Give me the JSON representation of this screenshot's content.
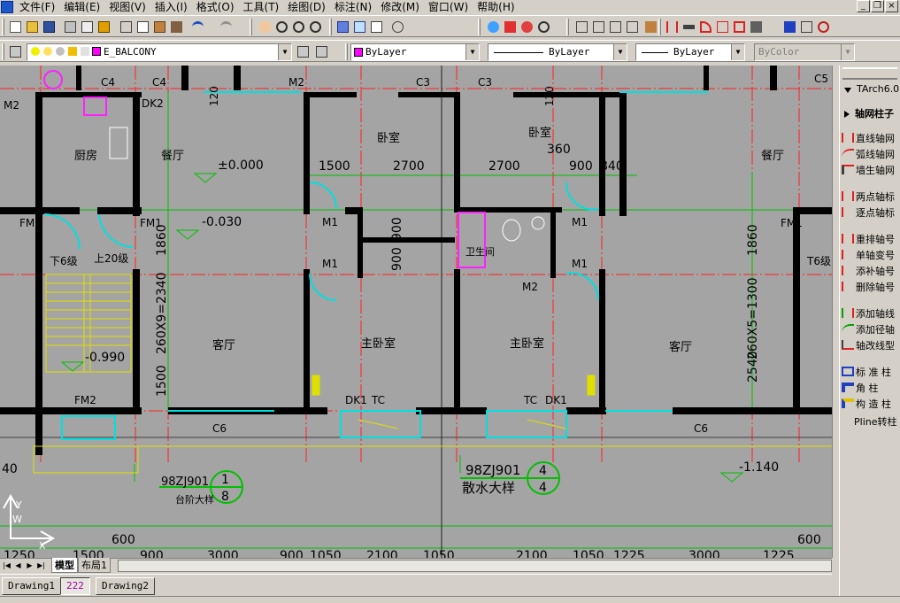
{
  "menu": {
    "items": [
      "文件(F)",
      "编辑(E)",
      "视图(V)",
      "插入(I)",
      "格式(O)",
      "工具(T)",
      "绘图(D)",
      "标注(N)",
      "修改(M)",
      "窗口(W)",
      "帮助(H)"
    ]
  },
  "window_buttons": [
    "_",
    "❐",
    "×"
  ],
  "layer_toolbar": {
    "layer_name": "E_BALCONY",
    "color_value": "ByLayer",
    "linetype_value": "ByLayer",
    "lineweight_value": "ByLayer",
    "plotstyle_value": "ByColor",
    "color_swatch": "#ff00ff"
  },
  "panel": {
    "title": "TArch6.0",
    "section": "轴网柱子",
    "items": [
      "直线轴网",
      "弧线轴网",
      "墙生轴网",
      "两点轴标",
      "逐点轴标",
      "重排轴号",
      "单轴变号",
      "添补轴号",
      "删除轴号",
      "添加轴线",
      "添加径轴",
      "轴改线型",
      "标 准 柱",
      "角 柱",
      "构 造 柱",
      "Pline转柱"
    ]
  },
  "drawing": {
    "rooms": [
      "厨房",
      "餐厅",
      "卧室",
      "卧室",
      "餐厅",
      "客厅",
      "主卧室",
      "主卧室",
      "客厅",
      "卫生间"
    ],
    "levels": [
      "±0.000",
      "-0.030",
      "-0.990",
      "-1.140"
    ],
    "windows": [
      "C4",
      "C4",
      "C3",
      "C3",
      "C5",
      "C6",
      "C6"
    ],
    "doors": [
      "M2",
      "M2",
      "DK2",
      "M1",
      "M1",
      "M1",
      "M1",
      "M2",
      "FM1",
      "FM1",
      "FM1",
      "FM2",
      "DK1",
      "TC",
      "TC",
      "DK1"
    ],
    "stair_labels": [
      "下6级",
      "上20级",
      "T6级"
    ],
    "dims_top": [
      "1500",
      "2700",
      "2700",
      "900",
      "840",
      "360"
    ],
    "dims_vertical": [
      "1860",
      "260X9=2340",
      "1500",
      "900",
      "900",
      "260X5=1300",
      "1860",
      "2540",
      "120",
      "120"
    ],
    "dims_bottom_1": [
      "40",
      "600",
      "600"
    ],
    "dims_bottom_2": [
      "1250",
      "1500",
      "900",
      "3000",
      "900",
      "1050",
      "2100",
      "1050",
      "2100",
      "1050",
      "1225",
      "3000",
      "1225"
    ],
    "detail_1": {
      "code": "98ZJ901",
      "label": "台阶大样",
      "num": "1",
      "den": "8"
    },
    "detail_2": {
      "code": "98ZJ901",
      "label": "散水大样",
      "num": "4",
      "den": "4"
    },
    "ucs_labels": {
      "y": "Y",
      "w": "W",
      "x": "X"
    }
  },
  "layout_tabs": {
    "model": "模型",
    "layout1": "布局1"
  },
  "doc_tabs": [
    "Drawing1",
    "222",
    "Drawing2"
  ]
}
